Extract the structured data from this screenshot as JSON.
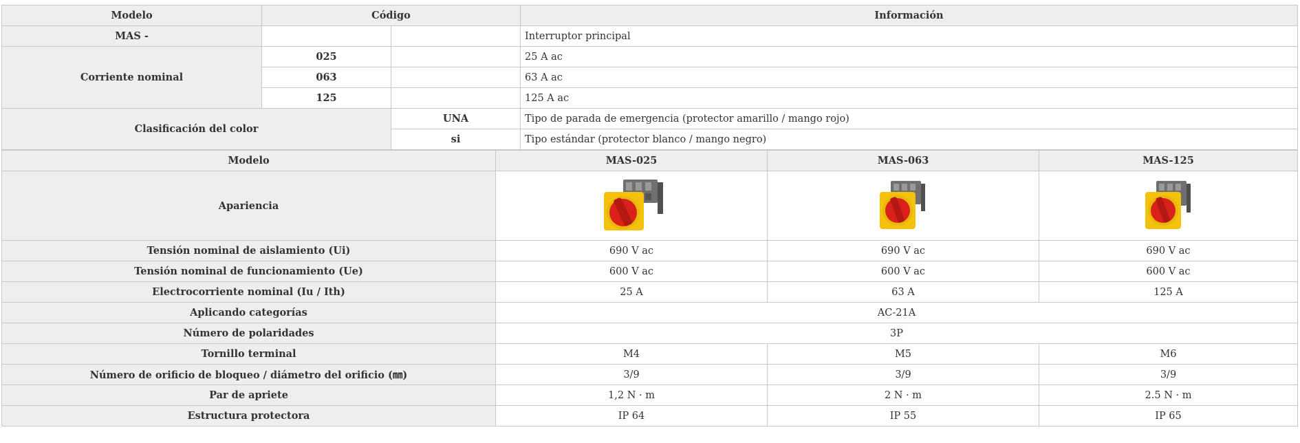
{
  "coding_table": {
    "headers": {
      "modelo": "Modelo",
      "codigo": "Código",
      "informacion": "Información"
    },
    "rows": {
      "mas": {
        "label": "MAS -",
        "info": "Interruptor principal"
      },
      "corriente": {
        "label": "Corriente nominal",
        "items": [
          {
            "code": "025",
            "info": "25 A ac"
          },
          {
            "code": "063",
            "info": "63 A ac"
          },
          {
            "code": "125",
            "info": "125 A ac"
          }
        ]
      },
      "color": {
        "label": "Clasificación del color",
        "items": [
          {
            "code": "UNA",
            "info": "Tipo de parada de emergencia (protector amarillo / mango rojo)"
          },
          {
            "code": "si",
            "info": "Tipo estándar (protector blanco / mango negro)"
          }
        ]
      }
    }
  },
  "spec_table": {
    "header": {
      "modelo": "Modelo",
      "models": [
        "MAS-025",
        "MAS-063",
        "MAS-125"
      ]
    },
    "appearance_label": "Apariencia",
    "product_image_icon": "rotary-switch-yellow-red-icon",
    "rows": {
      "tension_aislamiento": {
        "label": "Tensión nominal de aislamiento (Ui)",
        "values": [
          "690 V ac",
          "690 V ac",
          "690 V ac"
        ]
      },
      "tension_funcionamiento": {
        "label": "Tensión nominal de funcionamiento (Ue)",
        "values": [
          "600 V ac",
          "600 V ac",
          "600 V ac"
        ]
      },
      "electrocorriente": {
        "label": "Electrocorriente nominal (Iu / Ith)",
        "values": [
          "25 A",
          "63 A",
          "125 A"
        ]
      },
      "categorias": {
        "label": "Aplicando categorías",
        "value": "AC-21A"
      },
      "polaridades": {
        "label": "Número de polaridades",
        "value": "3P"
      },
      "tornillo": {
        "label": "Tornillo terminal",
        "values": [
          "M4",
          "M5",
          "M6"
        ]
      },
      "orificio": {
        "label": "Número de orificio de bloqueo / diámetro del orificio (㎜)",
        "values": [
          "3/9",
          "3/9",
          "3/9"
        ]
      },
      "par": {
        "label": "Par de apriete",
        "values": [
          "1,2 N · m",
          "2 N · m",
          "2.5 N · m"
        ]
      },
      "estructura": {
        "label": "Estructura protectora",
        "values": [
          "IP 64",
          "IP 55",
          "IP 65"
        ]
      }
    }
  },
  "colors": {
    "header_bg": "#eeeeee",
    "border": "#c8c8c8",
    "switch_yellow": "#f4c20d",
    "switch_red": "#d9211a",
    "switch_body": "#7a7a7a"
  }
}
